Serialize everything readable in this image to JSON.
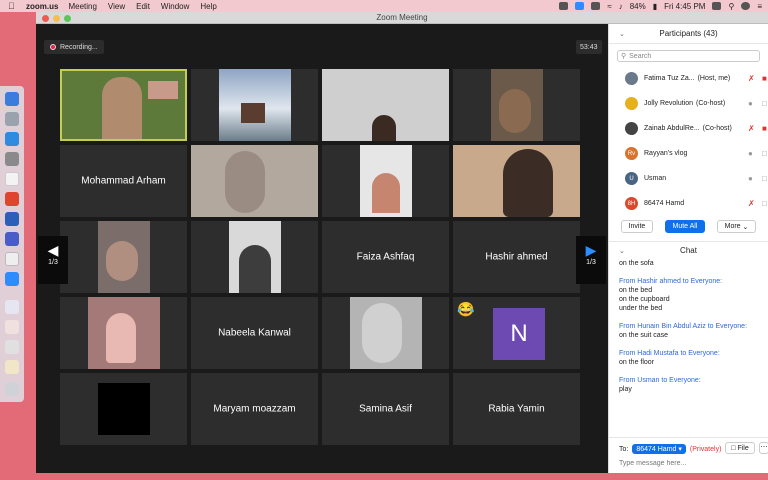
{
  "menubar": {
    "app": "zoom.us",
    "menus": [
      "Meeting",
      "View",
      "Edit",
      "Window",
      "Help"
    ],
    "battery": "84%",
    "clock": "Fri 4:45 PM"
  },
  "window": {
    "title": "Zoom Meeting"
  },
  "meeting": {
    "recording_label": "Recording...",
    "timer": "53:43",
    "page_left": "1/3",
    "page_right": "1/3",
    "tiles": [
      {
        "name": "",
        "video": true
      },
      {
        "name": "",
        "video": true
      },
      {
        "name": "",
        "video": true
      },
      {
        "name": "",
        "video": true
      },
      {
        "name": "Mohammad Arham",
        "video": false
      },
      {
        "name": "",
        "video": true
      },
      {
        "name": "",
        "video": true
      },
      {
        "name": "",
        "video": true
      },
      {
        "name": "",
        "video": true
      },
      {
        "name": "",
        "video": true
      },
      {
        "name": "Faiza Ashfaq",
        "video": false
      },
      {
        "name": "Hashir ahmed",
        "video": false
      },
      {
        "name": "",
        "video": true
      },
      {
        "name": "Nabeela Kanwal",
        "video": false
      },
      {
        "name": "",
        "video": true
      },
      {
        "name": "",
        "video": false,
        "avatar_letter": "N"
      },
      {
        "name": "",
        "video": true
      },
      {
        "name": "Maryam moazzam",
        "video": false
      },
      {
        "name": "Samina Asif",
        "video": false
      },
      {
        "name": "Rabia Yamin",
        "video": false
      }
    ]
  },
  "participants": {
    "header": "Participants (43)",
    "search_placeholder": "Search",
    "list": [
      {
        "name": "Fatima Tuz Za...",
        "role": "(Host, me)",
        "mic": "muted",
        "cam": "off",
        "avatar_color": "#6a7a8a"
      },
      {
        "name": "Jolly Revolution",
        "role": "(Co-host)",
        "mic": "on",
        "cam": "on",
        "avatar_color": "#e7b11d"
      },
      {
        "name": "Zainab AbdulRe...",
        "role": "(Co-host)",
        "mic": "muted",
        "cam": "off",
        "avatar_color": "#444444"
      },
      {
        "name": "Rayyan's vlog",
        "role": "",
        "mic": "on",
        "cam": "on",
        "avatar_color": "#d9722c",
        "initials": "Rv"
      },
      {
        "name": "Usman",
        "role": "",
        "mic": "on",
        "cam": "on",
        "avatar_color": "#4a6584",
        "initials": "U"
      },
      {
        "name": "86474 Hamd",
        "role": "",
        "mic": "muted",
        "cam": "on",
        "avatar_color": "#d9492c",
        "initials": "8H"
      }
    ],
    "buttons": {
      "invite": "Invite",
      "mute_all": "Mute All",
      "more": "More"
    }
  },
  "chat": {
    "header": "Chat",
    "messages": [
      {
        "from": "",
        "text": [
          "on the sofa"
        ]
      },
      {
        "from": "From Hashir ahmed to Everyone:",
        "text": [
          "on the bed",
          "on the cupboard",
          "under the bed"
        ]
      },
      {
        "from": "From Hunain Bin Abdul Aziz to Everyone:",
        "text": [
          "on the suit case"
        ]
      },
      {
        "from": "From Hadi Mustafa to Everyone:",
        "text": [
          "on the floor"
        ]
      },
      {
        "from": "From Usman to Everyone:",
        "text": [
          "play"
        ]
      }
    ],
    "to_label": "To:",
    "to_recipient": "86474 Hamd",
    "privately": "(Privately)",
    "file_button": "File",
    "input_placeholder": "Type message here..."
  }
}
